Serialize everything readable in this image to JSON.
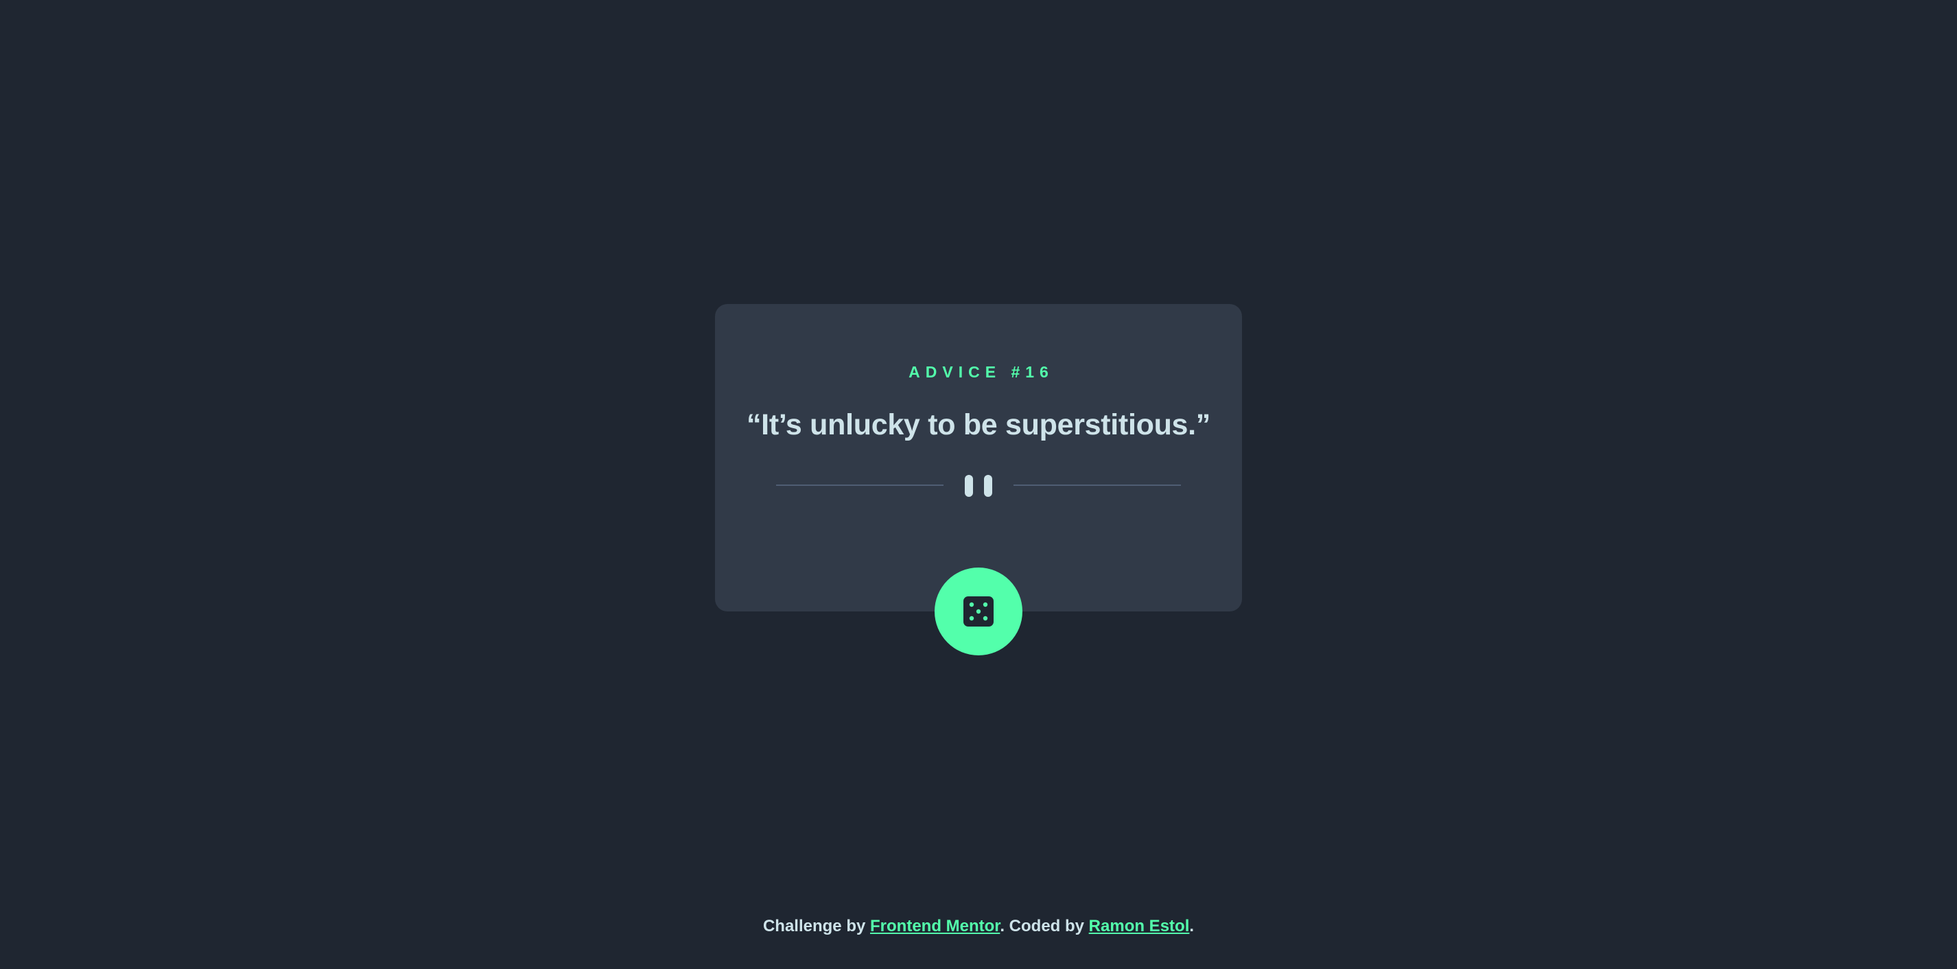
{
  "advice": {
    "label": "ADVICE #16",
    "quote": "“It’s unlucky to be superstitious.”"
  },
  "divider": {
    "icon": "pause-icon"
  },
  "action": {
    "icon": "dice-icon"
  },
  "footer": {
    "prefix": "Challenge by ",
    "challenge_link": "Frontend Mentor",
    "middle": ". Coded by ",
    "author_link": "Ramon Estol",
    "suffix": "."
  },
  "colors": {
    "background": "#1f2631",
    "card": "#313a48",
    "accent": "#53ffab",
    "text": "#cee3e9",
    "divider": "#4f5d74"
  }
}
